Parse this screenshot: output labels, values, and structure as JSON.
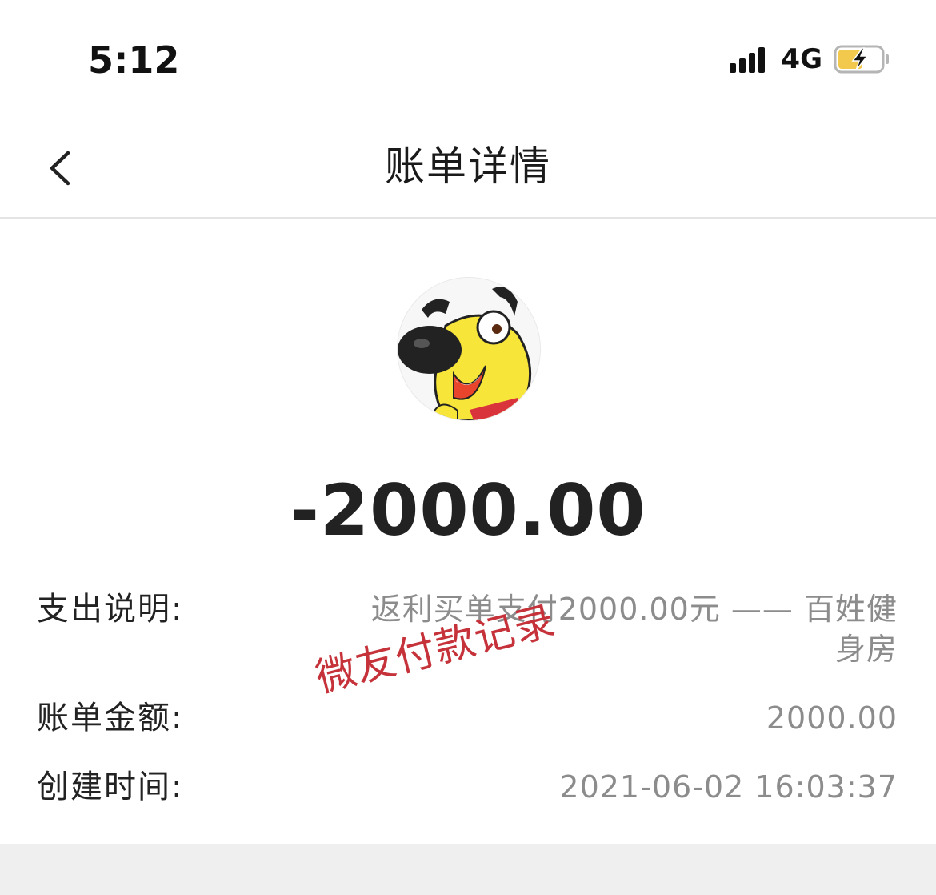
{
  "status_bar": {
    "time": "5:12",
    "network": "4G",
    "icons": [
      "signal-icon",
      "battery-charging-icon"
    ]
  },
  "nav": {
    "title": "账单详情",
    "back_icon": "chevron-left-icon"
  },
  "avatar": {
    "icon": "dog-avatar-icon"
  },
  "amount": "-2000.00",
  "details": {
    "description_label": "支出说明:",
    "description_value": "返利买单支付2000.00元 —— 百姓健身房",
    "amount_label": "账单金额:",
    "amount_value": "2000.00",
    "time_label": "创建时间:",
    "time_value": "2021-06-02 16:03:37"
  },
  "stamp": "微友付款记录",
  "colors": {
    "stamp": "#c6323a",
    "value_gray": "#8c8c8c",
    "battery": "#f2c94c",
    "background_gray": "#efefef"
  }
}
